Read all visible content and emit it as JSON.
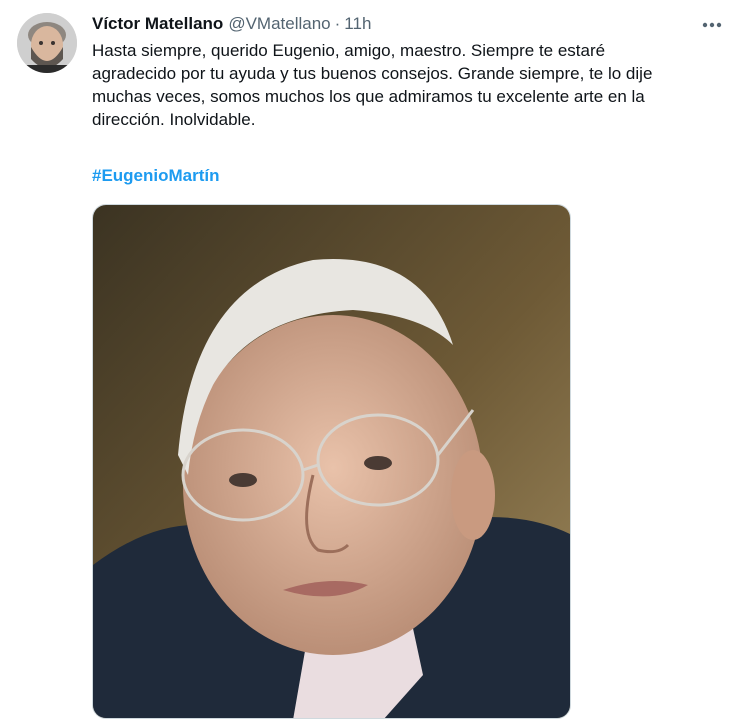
{
  "tweet": {
    "author_name": "Víctor Matellano",
    "handle": "@VMatellano",
    "separator": "·",
    "time": "11h",
    "text": "Hasta siempre, querido Eugenio, amigo, maestro. Siempre te estaré\nagradecido por tu ayuda y tus buenos consejos. Grande siempre, te lo dije\nmuchas veces, somos muchos los que admiramos tu excelente arte en la\ndirección. Inolvidable.",
    "hashtag": "#EugenioMartín"
  },
  "icons": {
    "more": "more-horizontal-icon"
  },
  "colors": {
    "text": "#0f1419",
    "secondary": "#536471",
    "link": "#1d9bf0"
  }
}
